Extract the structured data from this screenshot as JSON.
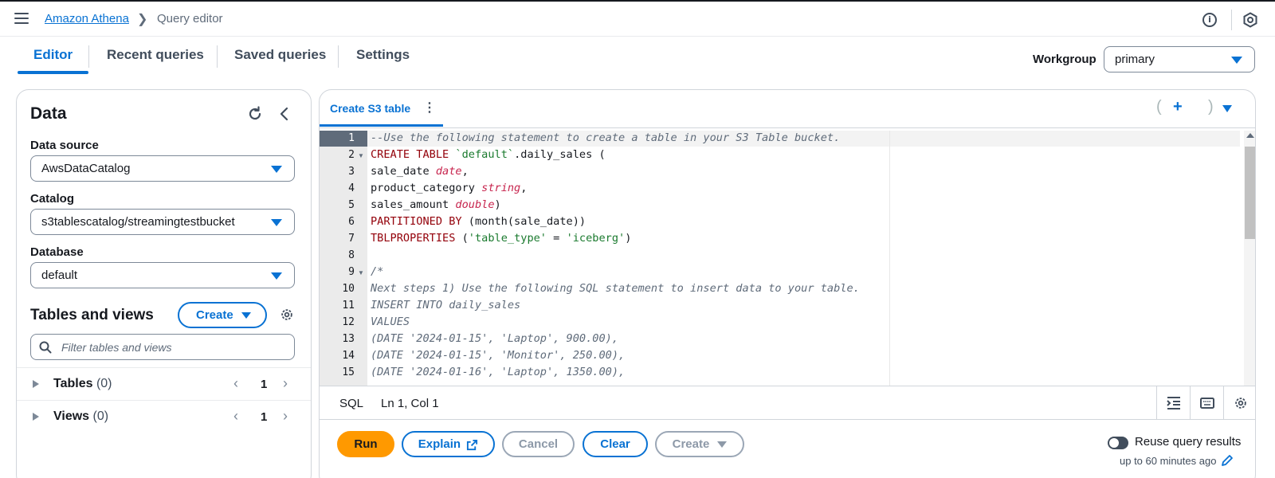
{
  "header": {
    "breadcrumb_link": "Amazon Athena",
    "breadcrumb_sep": "❯",
    "breadcrumb_current": "Query editor",
    "info_glyph": "i",
    "icons": [
      "menu-icon",
      "info-icon",
      "settings-hexagon-icon"
    ]
  },
  "tabs": {
    "items": [
      {
        "label": "Editor",
        "active": true
      },
      {
        "label": "Recent queries",
        "active": false
      },
      {
        "label": "Saved queries",
        "active": false
      },
      {
        "label": "Settings",
        "active": false
      }
    ]
  },
  "workgroup": {
    "label": "Workgroup",
    "value": "primary"
  },
  "data_panel": {
    "title": "Data",
    "data_source": {
      "label": "Data source",
      "value": "AwsDataCatalog"
    },
    "catalog": {
      "label": "Catalog",
      "value": "s3tablescatalog/streamingtestbucket"
    },
    "database": {
      "label": "Database",
      "value": "default"
    },
    "tables_and_views": {
      "title": "Tables and views",
      "create_label": "Create",
      "filter_placeholder": "Filter tables and views"
    },
    "groups": [
      {
        "name": "Tables",
        "count": "(0)",
        "page": "1"
      },
      {
        "name": "Views",
        "count": "(0)",
        "page": "1"
      }
    ],
    "nav": {
      "prev": "‹",
      "next": "›"
    }
  },
  "editor": {
    "tab_label": "Create S3 table",
    "tab_menu": "⋮",
    "add_tab": "+",
    "paren_open": "(",
    "paren_close": ")",
    "lines": [
      "--Use the following statement to create a table in your S3 Table bucket.",
      "CREATE TABLE `default`.daily_sales (",
      "sale_date date,",
      "product_category string,",
      "sales_amount double)",
      "PARTITIONED BY (month(sale_date))",
      "TBLPROPERTIES ('table_type' = 'iceberg')",
      "",
      "/*",
      "Next steps 1) Use the following SQL statement to insert data to your table.",
      "INSERT INTO daily_sales",
      "VALUES",
      "(DATE '2024-01-15', 'Laptop', 900.00),",
      "(DATE '2024-01-15', 'Monitor', 250.00),",
      "(DATE '2024-01-16', 'Laptop', 1350.00),"
    ],
    "line_numbers": [
      "1",
      "2",
      "3",
      "4",
      "5",
      "6",
      "7",
      "8",
      "9",
      "10",
      "11",
      "12",
      "13",
      "14",
      "15"
    ],
    "fold_glyph": "▼",
    "status": {
      "language": "SQL",
      "cursor": "Ln 1, Col 1"
    }
  },
  "actions": {
    "run": "Run",
    "explain": "Explain",
    "cancel": "Cancel",
    "clear": "Clear",
    "create": "Create",
    "reuse_label": "Reuse query results",
    "reuse_sub": "up to 60 minutes ago"
  },
  "colors": {
    "accent": "#0972d3",
    "run_button": "#ff9900",
    "keyword": "#93000a",
    "type": "#c7254e",
    "string": "#1a7a2e",
    "comment": "#5f6b7a"
  }
}
